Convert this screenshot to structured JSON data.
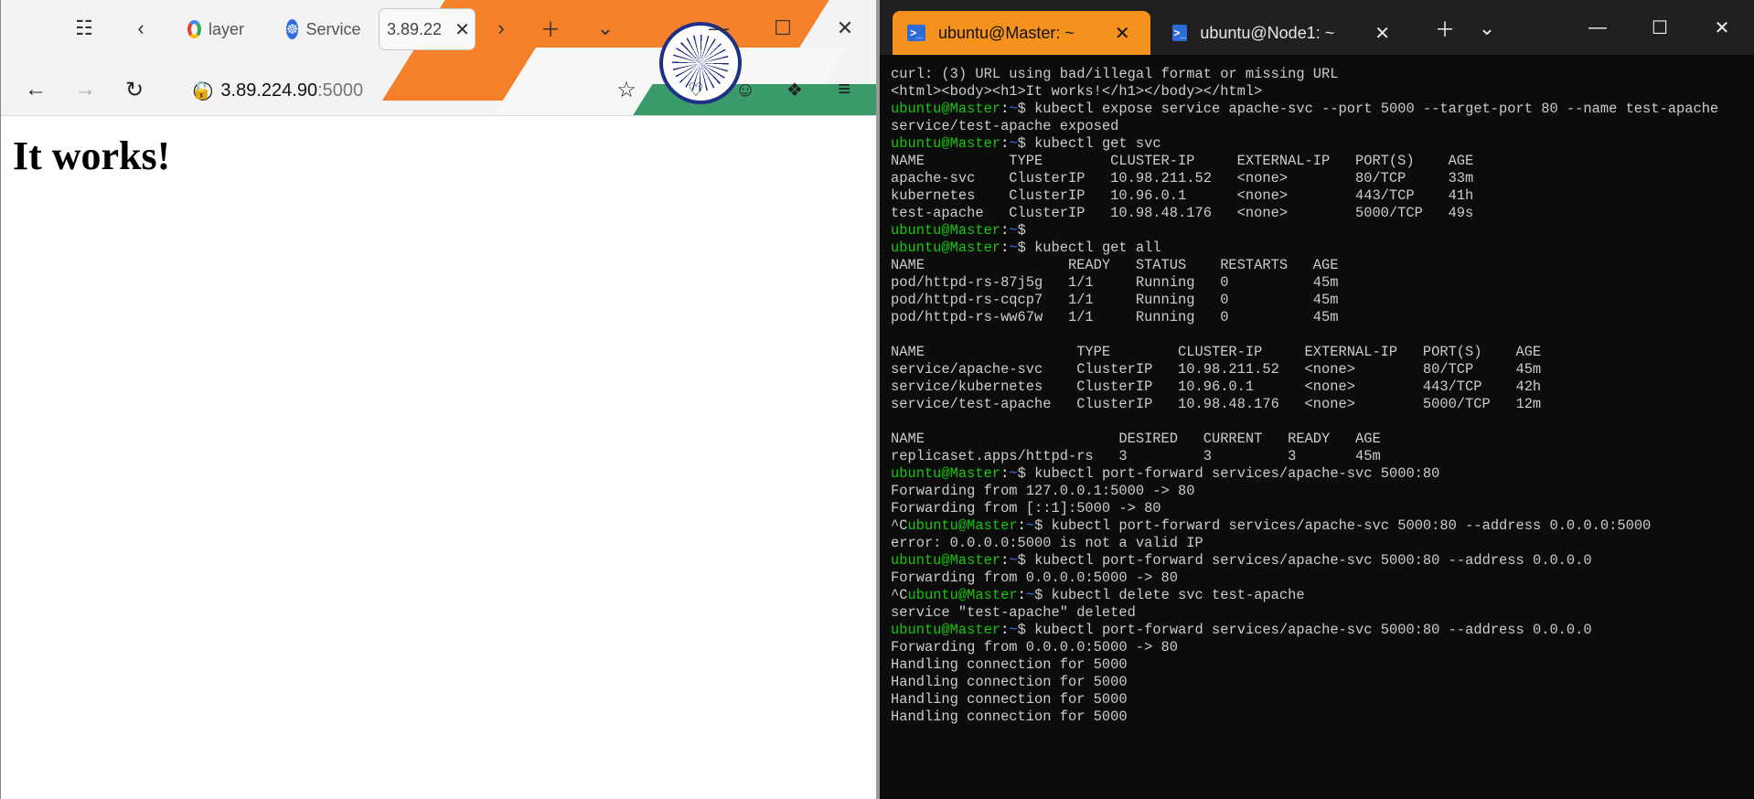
{
  "browser": {
    "tabs": [
      {
        "label": "layer",
        "icon": "google-icon"
      },
      {
        "label": "Service",
        "icon": "kubernetes-icon"
      },
      {
        "label": "3.89.22",
        "active": true
      }
    ],
    "url": {
      "host": "3.89.224.90",
      "port": ":5000"
    },
    "page": {
      "heading": "It works!"
    }
  },
  "terminal": {
    "tabs": [
      {
        "label": "ubuntu@Master: ~",
        "active": true
      },
      {
        "label": "ubuntu@Node1: ~"
      }
    ],
    "prompt": {
      "user": "ubuntu@Master",
      "sep": ":",
      "path": "~",
      "symbol": "$ "
    },
    "lines": [
      {
        "text": "curl: (3) URL using bad/illegal format or missing URL"
      },
      {
        "text": "<html><body><h1>It works!</h1></body></html>"
      },
      {
        "prompt": true,
        "text": "kubectl expose service apache-svc --port 5000 --target-port 80 --name test-apache"
      },
      {
        "text": "service/test-apache exposed"
      },
      {
        "prompt": true,
        "text": "kubectl get svc"
      },
      {
        "text": "NAME          TYPE        CLUSTER-IP     EXTERNAL-IP   PORT(S)    AGE"
      },
      {
        "text": "apache-svc    ClusterIP   10.98.211.52   <none>        80/TCP     33m"
      },
      {
        "text": "kubernetes    ClusterIP   10.96.0.1      <none>        443/TCP    41h"
      },
      {
        "text": "test-apache   ClusterIP   10.98.48.176   <none>        5000/TCP   49s"
      },
      {
        "prompt": true,
        "text": ""
      },
      {
        "prompt": true,
        "text": "kubectl get all"
      },
      {
        "text": "NAME                 READY   STATUS    RESTARTS   AGE"
      },
      {
        "text": "pod/httpd-rs-87j5g   1/1     Running   0          45m"
      },
      {
        "text": "pod/httpd-rs-cqcp7   1/1     Running   0          45m"
      },
      {
        "text": "pod/httpd-rs-ww67w   1/1     Running   0          45m"
      },
      {
        "text": ""
      },
      {
        "text": "NAME                  TYPE        CLUSTER-IP     EXTERNAL-IP   PORT(S)    AGE"
      },
      {
        "text": "service/apache-svc    ClusterIP   10.98.211.52   <none>        80/TCP     45m"
      },
      {
        "text": "service/kubernetes    ClusterIP   10.96.0.1      <none>        443/TCP    42h"
      },
      {
        "text": "service/test-apache   ClusterIP   10.98.48.176   <none>        5000/TCP   12m"
      },
      {
        "text": ""
      },
      {
        "text": "NAME                       DESIRED   CURRENT   READY   AGE"
      },
      {
        "text": "replicaset.apps/httpd-rs   3         3         3       45m"
      },
      {
        "prompt": true,
        "text": "kubectl port-forward services/apache-svc 5000:80"
      },
      {
        "text": "Forwarding from 127.0.0.1:5000 -> 80"
      },
      {
        "text": "Forwarding from [::1]:5000 -> 80"
      },
      {
        "prompt": true,
        "pre": "^C",
        "text": "kubectl port-forward services/apache-svc 5000:80 --address 0.0.0.0:5000"
      },
      {
        "text": "error: 0.0.0.0:5000 is not a valid IP"
      },
      {
        "prompt": true,
        "text": "kubectl port-forward services/apache-svc 5000:80 --address 0.0.0.0"
      },
      {
        "text": "Forwarding from 0.0.0.0:5000 -> 80"
      },
      {
        "prompt": true,
        "pre": "^C",
        "text": "kubectl delete svc test-apache"
      },
      {
        "text": "service \"test-apache\" deleted"
      },
      {
        "prompt": true,
        "text": "kubectl port-forward services/apache-svc 5000:80 --address 0.0.0.0"
      },
      {
        "text": "Forwarding from 0.0.0.0:5000 -> 80"
      },
      {
        "text": "Handling connection for 5000"
      },
      {
        "text": "Handling connection for 5000"
      },
      {
        "text": "Handling connection for 5000"
      },
      {
        "text": "Handling connection for 5000"
      }
    ]
  },
  "colors": {
    "terminal_bg": "#0c0c0c",
    "terminal_text": "#cccccc",
    "prompt_user": "#16c60c",
    "prompt_path": "#3b78ff",
    "active_tab": "#f4921d"
  }
}
